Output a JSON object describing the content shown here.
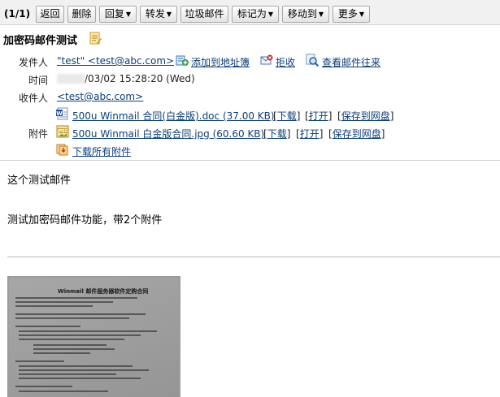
{
  "toolbar": {
    "counter": "(1/1)",
    "buttons": {
      "back": "返回",
      "delete": "删除",
      "reply": "回复",
      "forward": "转发",
      "spam": "垃圾邮件",
      "mark_as": "标记为",
      "move_to": "移动到",
      "more": "更多"
    }
  },
  "mail": {
    "subject": "加密码邮件测试",
    "from_label": "发件人",
    "from_value": "\"test\" <test@abc.com>",
    "add_to_addressbook": "添加到地址簿",
    "reject": "拒收",
    "view_correspondence": "查看邮件往来",
    "time_label": "时间",
    "time_value": "/03/02 15:28:20 (Wed)",
    "to_label": "收件人",
    "to_value": "<test@abc.com>",
    "attachments_label": "附件",
    "attachments": [
      {
        "icon": "word-doc-icon",
        "name": "500u Winmail 合同(白金版).doc (37.00 KB)",
        "download": "下载",
        "open": "打开",
        "save": "保存到网盘"
      },
      {
        "icon": "jpeg-icon",
        "name": "500u Winmail 白金版合同.jpg (60.60 KB)",
        "download": "下载",
        "open": "打开",
        "save": "保存到网盘"
      }
    ],
    "download_all": "下载所有附件",
    "body_line1": "这个测试邮件",
    "body_line2": "测试加密码邮件功能，带2个附件",
    "image_title": "Winmail 邮件服务器软件定购合同"
  },
  "colors": {
    "link": "#0b3f7a",
    "toolbar_bg": "#f1f1f1"
  }
}
